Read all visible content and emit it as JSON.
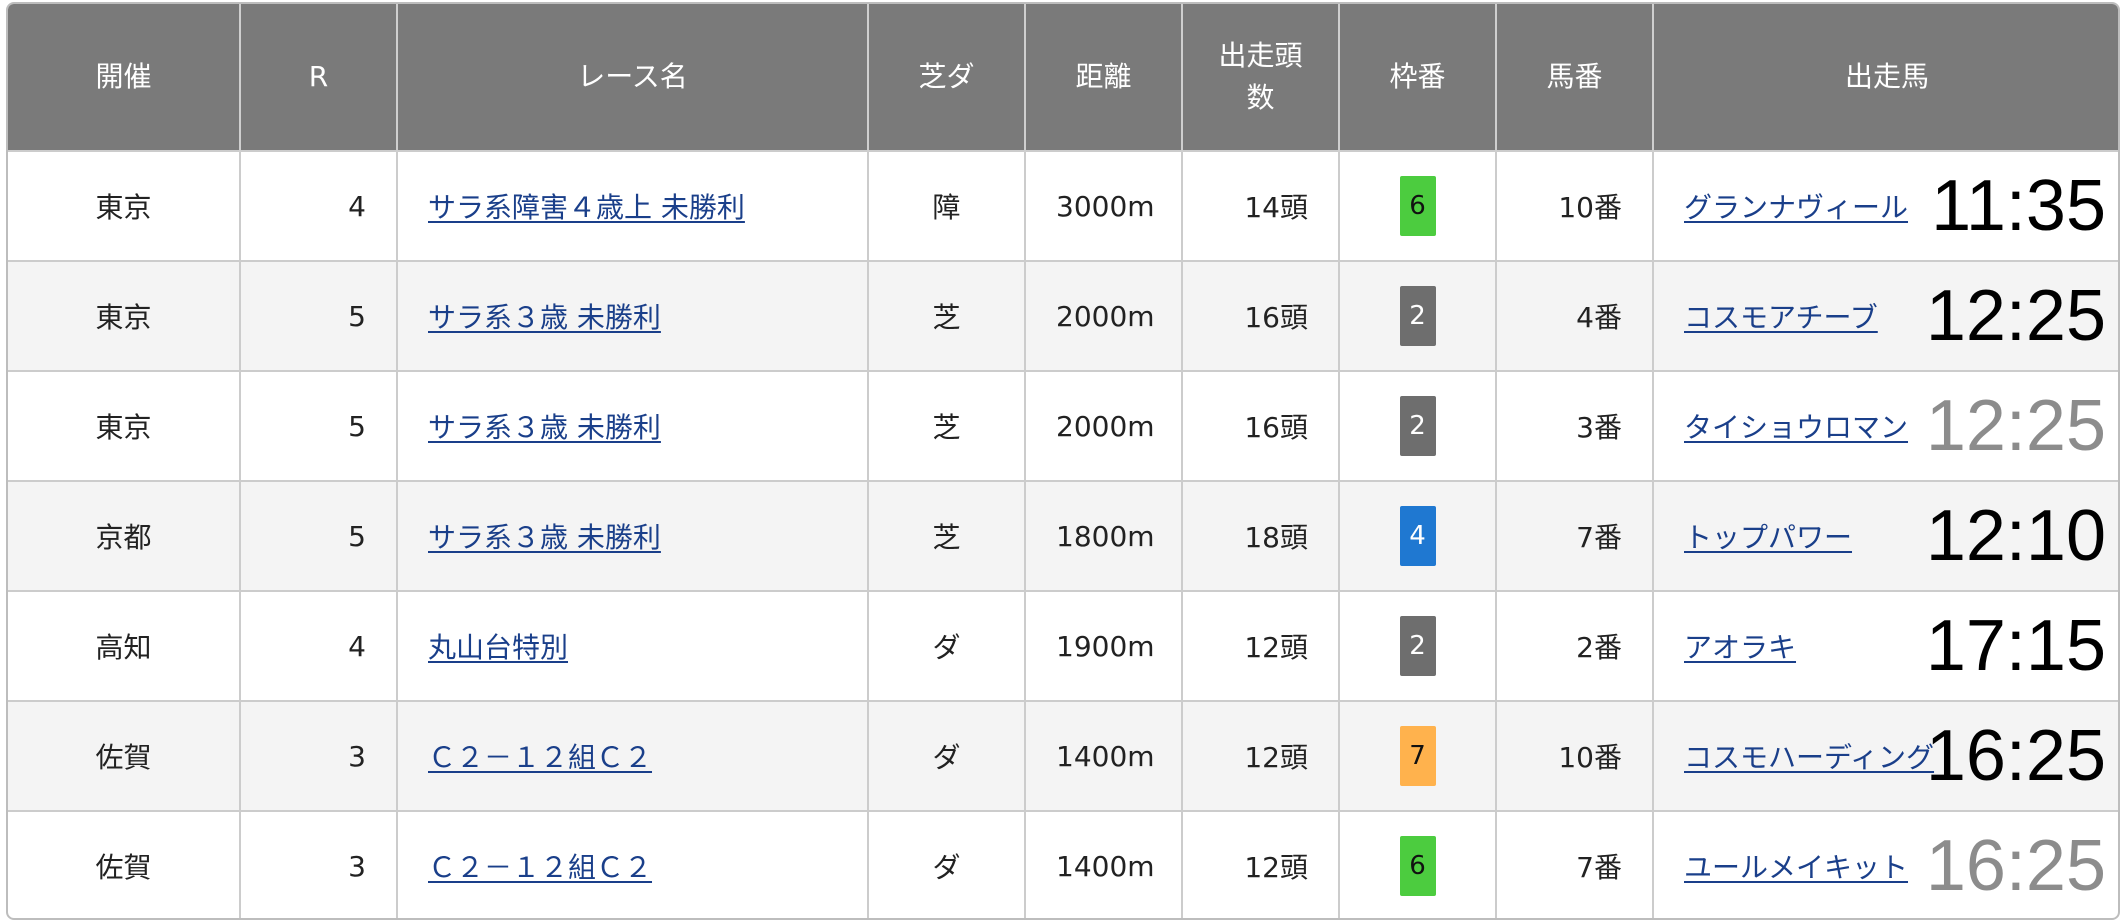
{
  "headers": {
    "venue": "開催",
    "race_no": "R",
    "race_name": "レース名",
    "surface": "芝ダ",
    "distance": "距離",
    "runners_line1": "出走頭",
    "runners_line2": "数",
    "frame": "枠番",
    "horse_no": "馬番",
    "horse": "出走馬"
  },
  "rows": [
    {
      "venue": "東京",
      "race_no": "4",
      "race_name": "サラ系障害４歳上 未勝利",
      "surface": "障",
      "distance": "3000m",
      "runners": "14頭",
      "frame": "6",
      "frame_color": "#4ccc3f",
      "frame_text_color": "#111111",
      "horse_no": "10番",
      "horse": "グランナヴィール",
      "time": "11:35",
      "time_muted": false
    },
    {
      "venue": "東京",
      "race_no": "5",
      "race_name": "サラ系３歳 未勝利",
      "surface": "芝",
      "distance": "2000m",
      "runners": "16頭",
      "frame": "2",
      "frame_color": "#6e6e6e",
      "frame_text_color": "#ffffff",
      "horse_no": "4番",
      "horse": "コスモアチーブ",
      "time": "12:25",
      "time_muted": false
    },
    {
      "venue": "東京",
      "race_no": "5",
      "race_name": "サラ系３歳 未勝利",
      "surface": "芝",
      "distance": "2000m",
      "runners": "16頭",
      "frame": "2",
      "frame_color": "#6e6e6e",
      "frame_text_color": "#ffffff",
      "horse_no": "3番",
      "horse": "タイショウロマン",
      "time": "12:25",
      "time_muted": true
    },
    {
      "venue": "京都",
      "race_no": "5",
      "race_name": "サラ系３歳 未勝利",
      "surface": "芝",
      "distance": "1800m",
      "runners": "18頭",
      "frame": "4",
      "frame_color": "#1f78d1",
      "frame_text_color": "#ffffff",
      "horse_no": "7番",
      "horse": "トップパワー",
      "time": "12:10",
      "time_muted": false
    },
    {
      "venue": "高知",
      "race_no": "4",
      "race_name": "丸山台特別",
      "surface": "ダ",
      "distance": "1900m",
      "runners": "12頭",
      "frame": "2",
      "frame_color": "#6e6e6e",
      "frame_text_color": "#ffffff",
      "horse_no": "2番",
      "horse": "アオラキ",
      "time": "17:15",
      "time_muted": false
    },
    {
      "venue": "佐賀",
      "race_no": "3",
      "race_name": "Ｃ２－１２組Ｃ２",
      "surface": "ダ",
      "distance": "1400m",
      "runners": "12頭",
      "frame": "7",
      "frame_color": "#ffb24d",
      "frame_text_color": "#111111",
      "horse_no": "10番",
      "horse": "コスモハーディング",
      "time": "16:25",
      "time_muted": false
    },
    {
      "venue": "佐賀",
      "race_no": "3",
      "race_name": "Ｃ２－１２組Ｃ２",
      "surface": "ダ",
      "distance": "1400m",
      "runners": "12頭",
      "frame": "6",
      "frame_color": "#4ccc3f",
      "frame_text_color": "#111111",
      "horse_no": "7番",
      "horse": "ユールメイキット",
      "time": "16:25",
      "time_muted": true
    }
  ]
}
